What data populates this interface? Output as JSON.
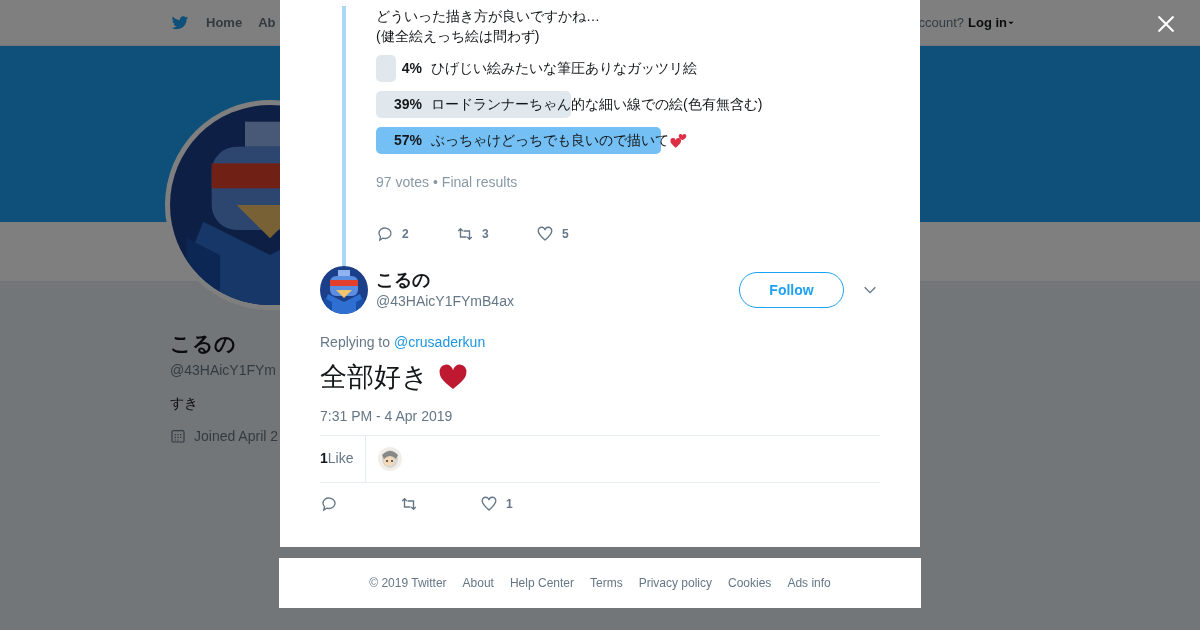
{
  "background": {
    "nav": [
      {
        "label": "Home"
      },
      {
        "label": "Ab"
      }
    ],
    "login_prompt": "ccount?",
    "login": "Log in",
    "profile": {
      "name": "こるの",
      "handle": "@43HAicY1FYm",
      "bio": "すき",
      "joined": "Joined April 2"
    }
  },
  "poll_tweet": {
    "text_lines": [
      "どういった描き方が良いですかね…",
      "(健全絵えっち絵は問わず)"
    ],
    "choices": [
      {
        "percent": "4%",
        "label": "ひげじい絵みたいな筆圧ありなガッツリ絵",
        "leading": false
      },
      {
        "percent": "39%",
        "label": "ロードランナーちゃん的な細い線での絵(色有無含む)",
        "leading": false
      },
      {
        "percent": "57%",
        "label": "ぶっちゃけどっちでも良いので描いて",
        "leading": true
      }
    ],
    "votes": "97 votes",
    "separator": "•",
    "status": "Final results",
    "actions": [
      {
        "kind": "reply",
        "count": "2"
      },
      {
        "kind": "retweet",
        "count": "3"
      },
      {
        "kind": "like",
        "count": "5"
      }
    ]
  },
  "reply_tweet": {
    "name": "こるの",
    "handle": "@43HAicY1FYmB4ax",
    "follow": "Follow",
    "replying_label": "Replying to",
    "replying_to": "@crusaderkun",
    "text": "全部好き",
    "time": "7:31 PM - 4 Apr 2019",
    "likes_count": "1",
    "likes_label": "Like",
    "actions": [
      {
        "kind": "reply"
      },
      {
        "kind": "retweet"
      },
      {
        "kind": "like",
        "count": "1"
      }
    ]
  },
  "footer": [
    "© 2019 Twitter",
    "About",
    "Help Center",
    "Terms",
    "Privacy policy",
    "Cookies",
    "Ads info"
  ]
}
